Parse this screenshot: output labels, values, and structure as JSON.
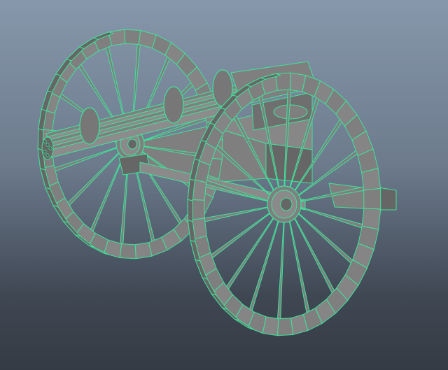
{
  "viewport": {
    "background_top": "#8797ab",
    "background_bottom": "#353b44"
  },
  "model": {
    "subject": "gatling-gun-on-wheeled-carriage",
    "display_mode": "wireframe-on-shaded",
    "wire_color": "#3fe39a",
    "surface_color": "#7f7f7f",
    "surface_dark_color": "#666666",
    "parts": [
      "rear-wheel",
      "front-wheel",
      "barrel-cluster",
      "carriage",
      "axle",
      "trail"
    ]
  }
}
